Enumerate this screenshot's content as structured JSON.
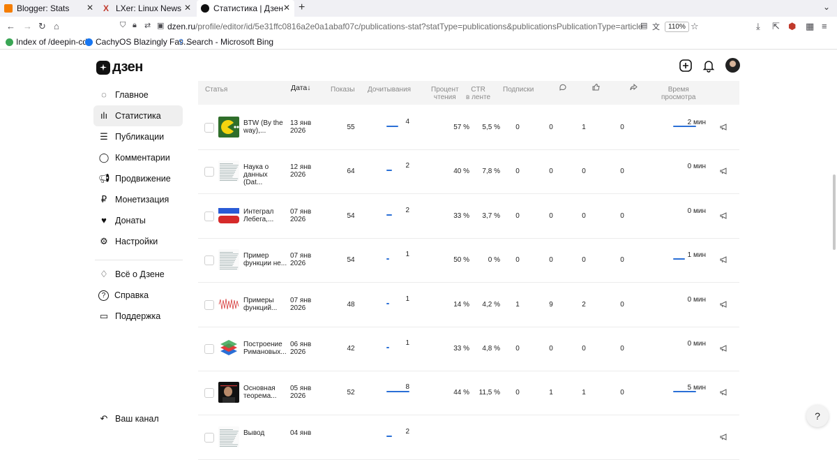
{
  "browser": {
    "tabs": [
      {
        "label": "Blogger: Stats",
        "icon": "blogger-icon"
      },
      {
        "label": "LXer: Linux News",
        "icon": "lxer-icon"
      },
      {
        "label": "Статистика | Дзен",
        "icon": "dzen-icon",
        "active": true
      }
    ],
    "url_host": "dzen.ru",
    "url_path": "/profile/editor/id/5e31ffc0816a2e0a1abaf07c/publications-stat?statType=publications&publicationsPublicationType=article",
    "zoom": "110%",
    "bookmarks": [
      {
        "label": "Index of /deepin-cd/",
        "color": "#3aa655"
      },
      {
        "label": "CachyOS Blazingly Fas...",
        "color": "#1877f2"
      },
      {
        "label": "Search - Microsoft Bing",
        "color": "#2a6fd6"
      }
    ]
  },
  "logo": "дзен",
  "sidebar": {
    "items": [
      {
        "label": "Главное",
        "icon": "home-icon"
      },
      {
        "label": "Статистика",
        "icon": "stats-icon",
        "active": true
      },
      {
        "label": "Публикации",
        "icon": "publications-icon"
      },
      {
        "label": "Комментарии",
        "icon": "comments-icon"
      },
      {
        "label": "Продвижение",
        "icon": "promotion-icon"
      },
      {
        "label": "Монетизация",
        "icon": "ruble-icon"
      },
      {
        "label": "Донаты",
        "icon": "donations-icon"
      },
      {
        "label": "Настройки",
        "icon": "settings-icon"
      }
    ],
    "secondary": [
      {
        "label": "Всё о Дзене",
        "icon": "about-icon"
      },
      {
        "label": "Справка",
        "icon": "help-icon"
      },
      {
        "label": "Поддержка",
        "icon": "support-icon"
      }
    ],
    "channel": "Ваш канал"
  },
  "table": {
    "headers": {
      "article": "Статья",
      "date": "Дата↓",
      "views": "Показы",
      "reads": "Дочитывания",
      "read_pct_1": "Процент",
      "read_pct_2": "чтения",
      "ctr_1": "CTR",
      "ctr_2": "в ленте",
      "subs": "Подписки",
      "time_1": "Время",
      "time_2": "просмотра"
    },
    "rows": [
      {
        "t1": "BTW (By the",
        "t2": "way),...",
        "d1": "13 янв",
        "d2": "2026",
        "views": "55",
        "reads": "4",
        "reads_fill": 0.5,
        "pct": "57 %",
        "ctr": "5,5 %",
        "subs": "0",
        "comments": "0",
        "likes": "1",
        "reposts": "0",
        "time": "2 мин",
        "time_fill": 1,
        "thumb": "pacman"
      },
      {
        "t1": "Наука о",
        "t2": "данных (Dat...",
        "d1": "12 янв",
        "d2": "2026",
        "views": "64",
        "reads": "2",
        "reads_fill": 0.25,
        "pct": "40 %",
        "ctr": "7,8 %",
        "subs": "0",
        "comments": "0",
        "likes": "0",
        "reposts": "0",
        "time": "0 мин",
        "time_fill": 0,
        "thumb": "doc"
      },
      {
        "t1": "Интеграл",
        "t2": "Лебега,...",
        "d1": "07 янв",
        "d2": "2026",
        "views": "54",
        "reads": "2",
        "reads_fill": 0.25,
        "pct": "33 %",
        "ctr": "3,7 %",
        "subs": "0",
        "comments": "0",
        "likes": "0",
        "reposts": "0",
        "time": "0 мин",
        "time_fill": 0,
        "thumb": "flag"
      },
      {
        "t1": "Пример",
        "t2": "функции не...",
        "d1": "07 янв",
        "d2": "2026",
        "views": "54",
        "reads": "1",
        "reads_fill": 0.12,
        "pct": "50 %",
        "ctr": "0 %",
        "subs": "0",
        "comments": "0",
        "likes": "0",
        "reposts": "0",
        "time": "1 мин",
        "time_fill": 0.5,
        "thumb": "doc"
      },
      {
        "t1": "Примеры",
        "t2": "функций...",
        "d1": "07 янв",
        "d2": "2026",
        "views": "48",
        "reads": "1",
        "reads_fill": 0.12,
        "pct": "14 %",
        "ctr": "4,2 %",
        "subs": "1",
        "comments": "9",
        "likes": "2",
        "reposts": "0",
        "time": "0 мин",
        "time_fill": 0,
        "thumb": "wave"
      },
      {
        "t1": "Построение",
        "t2": "Римановых...",
        "d1": "06 янв",
        "d2": "2026",
        "views": "42",
        "reads": "1",
        "reads_fill": 0.12,
        "pct": "33 %",
        "ctr": "4,8 %",
        "subs": "0",
        "comments": "0",
        "likes": "0",
        "reposts": "0",
        "time": "0 мин",
        "time_fill": 0,
        "thumb": "layers"
      },
      {
        "t1": "Основная",
        "t2": "теорема...",
        "d1": "05 янв",
        "d2": "2026",
        "views": "52",
        "reads": "8",
        "reads_fill": 1,
        "pct": "44 %",
        "ctr": "11,5 %",
        "subs": "0",
        "comments": "1",
        "likes": "1",
        "reposts": "0",
        "time": "5 мин",
        "time_fill": 1,
        "thumb": "portrait"
      },
      {
        "t1": "Вывод",
        "t2": "",
        "d1": "04 янв",
        "d2": "",
        "views": "",
        "reads": "2",
        "reads_fill": 0.25,
        "pct": "",
        "ctr": "",
        "subs": "",
        "comments": "",
        "likes": "",
        "reposts": "",
        "time": "",
        "time_fill": 0,
        "thumb": "doc"
      }
    ]
  },
  "help_button": "?"
}
